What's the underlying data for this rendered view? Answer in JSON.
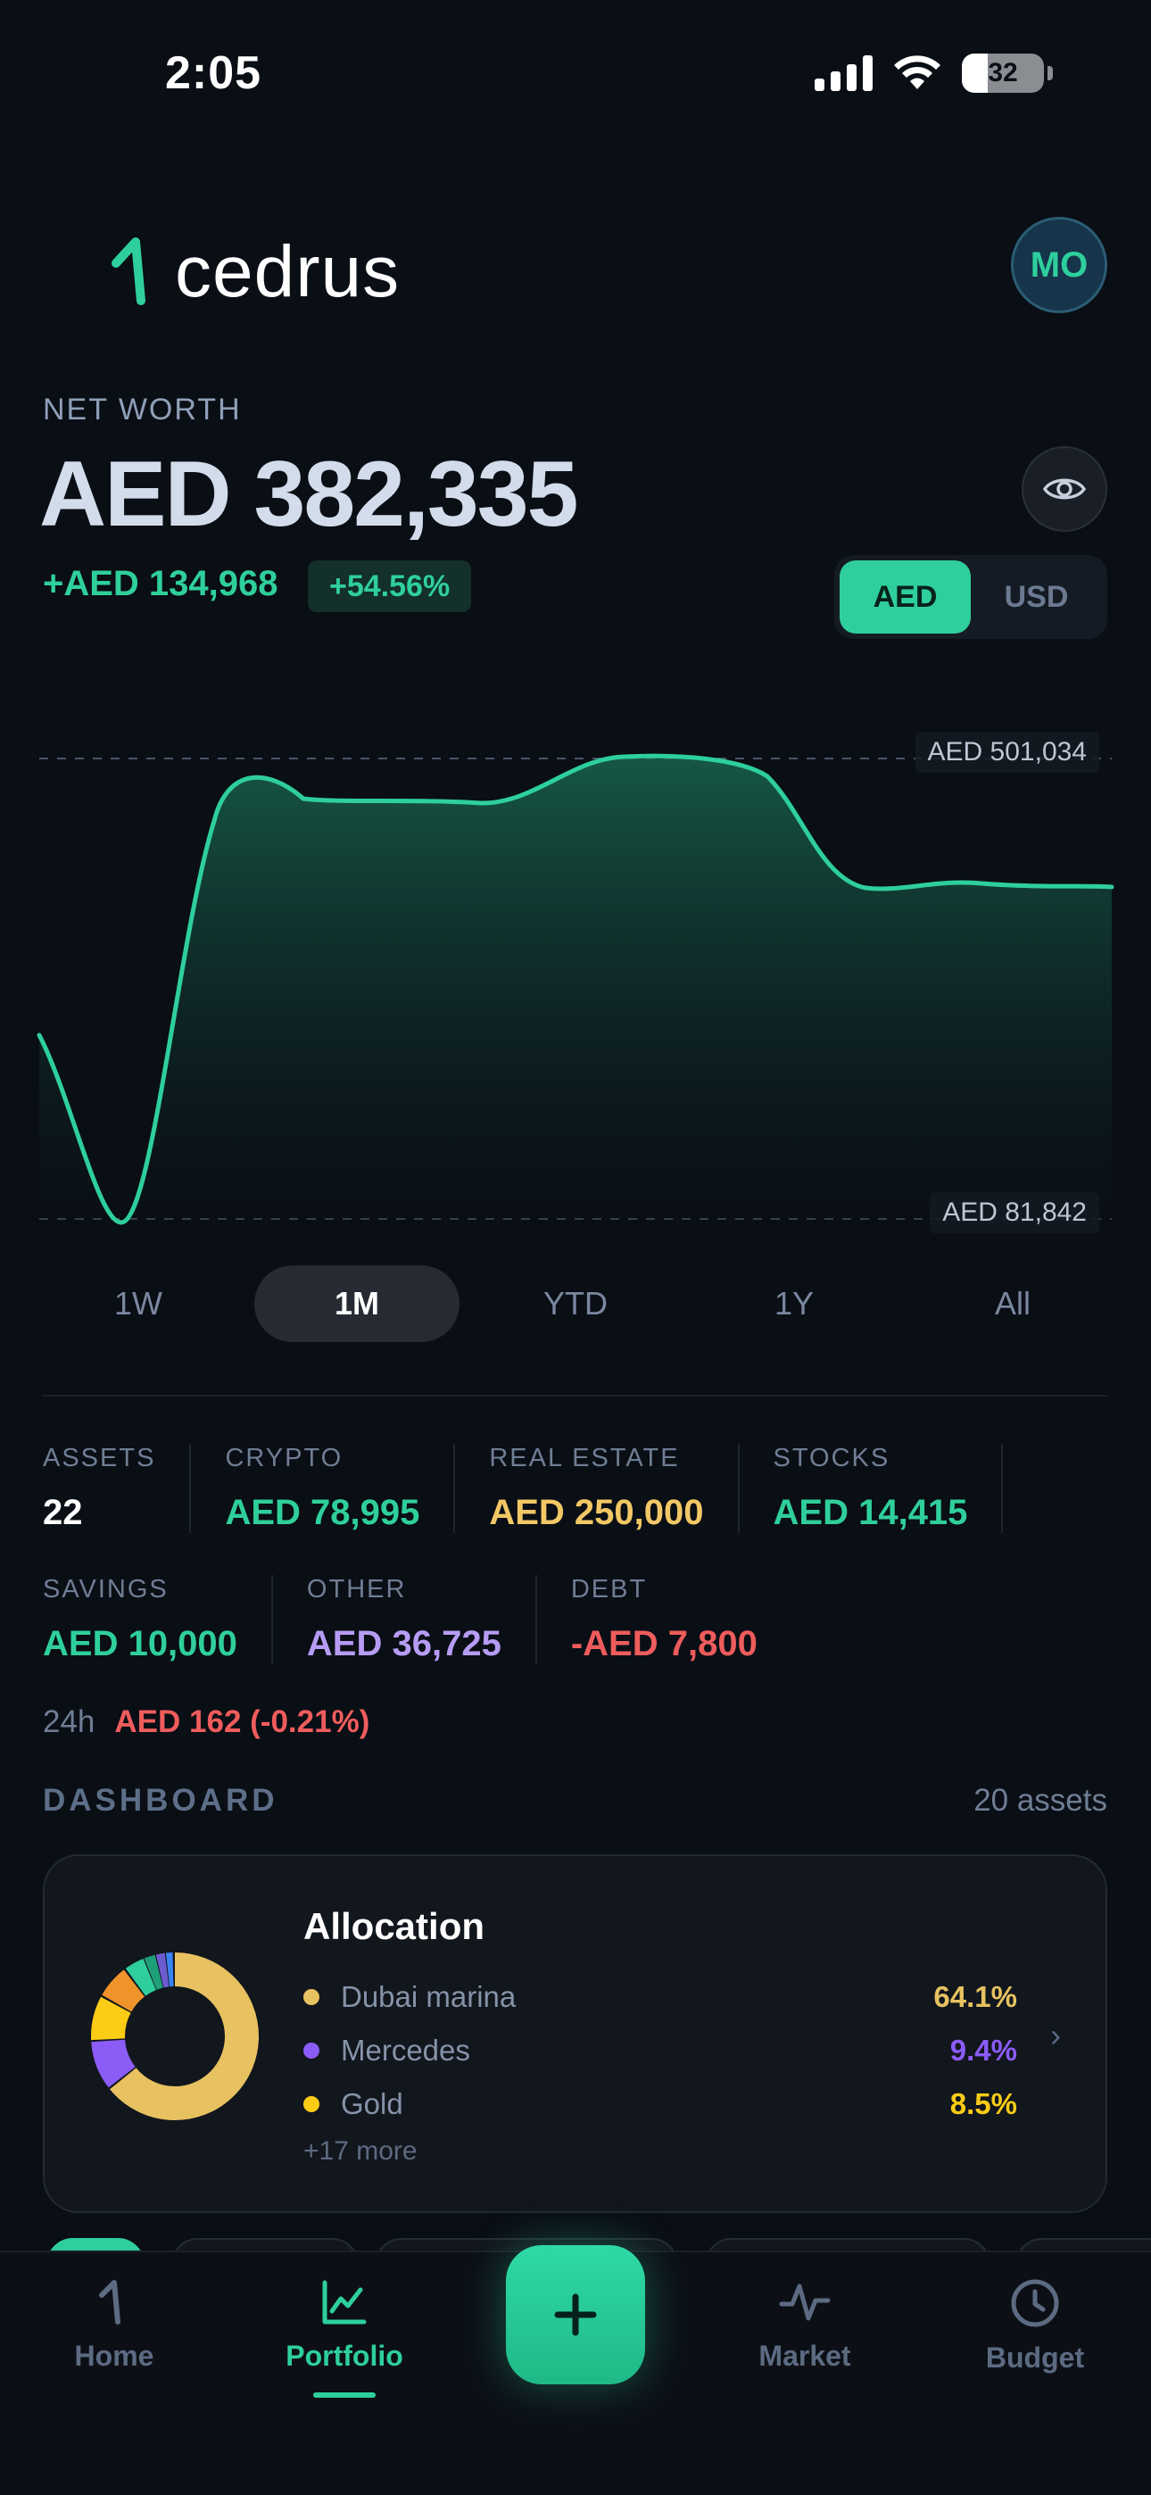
{
  "status_bar": {
    "time": "2:05",
    "battery": "32"
  },
  "header": {
    "brand": "cedrus",
    "avatar_initials": "MO"
  },
  "net_worth": {
    "label": "NET WORTH",
    "value": "AED 382,335",
    "change": "+AED 134,968",
    "change_pct": "+54.56%",
    "currency_options": [
      "AED",
      "USD"
    ],
    "selected_currency": "AED"
  },
  "chart": {
    "max_label": "AED 501,034",
    "min_label": "AED 81,842",
    "periods": [
      "1W",
      "1M",
      "YTD",
      "1Y",
      "All"
    ],
    "selected_period": "1M",
    "accent": "#2ecf9d"
  },
  "stats": {
    "row1": [
      {
        "label": "ASSETS",
        "value": "22",
        "color": "#ffffff"
      },
      {
        "label": "CRYPTO",
        "value": "AED 78,995",
        "color": "#2fcf9b"
      },
      {
        "label": "REAL ESTATE",
        "value": "AED 250,000",
        "color": "#f2c765"
      },
      {
        "label": "STOCKS",
        "value": "AED 14,415",
        "color": "#2fcf9b"
      }
    ],
    "row2": [
      {
        "label": "SAVINGS",
        "value": "AED 10,000",
        "color": "#2fcf9b"
      },
      {
        "label": "OTHER",
        "value": "AED 36,725",
        "color": "#b69cf5"
      },
      {
        "label": "DEBT",
        "value": "-AED 7,800",
        "color": "#ee5c5c"
      }
    ],
    "h24_label": "24h",
    "h24_value": "AED 162 (-0.21%)"
  },
  "dashboard": {
    "title": "DASHBOARD",
    "count": "20 assets",
    "allocation": {
      "title": "Allocation",
      "items": [
        {
          "name": "Dubai marina",
          "pct": "64.1%",
          "color": "#e8c260"
        },
        {
          "name": "Mercedes",
          "pct": "9.4%",
          "color": "#8b5cf6"
        },
        {
          "name": "Gold",
          "pct": "8.5%",
          "color": "#facc15"
        }
      ],
      "more": "+17 more",
      "chevron": "›"
    }
  },
  "bottom_nav": {
    "items": [
      {
        "label": "Home",
        "icon": "cedrus-logo-icon"
      },
      {
        "label": "Portfolio",
        "icon": "chart-icon"
      },
      {
        "label": "Market",
        "icon": "pulse-icon"
      },
      {
        "label": "Budget",
        "icon": "clock-icon"
      }
    ],
    "active": "Portfolio",
    "fab_icon": "plus-icon"
  }
}
